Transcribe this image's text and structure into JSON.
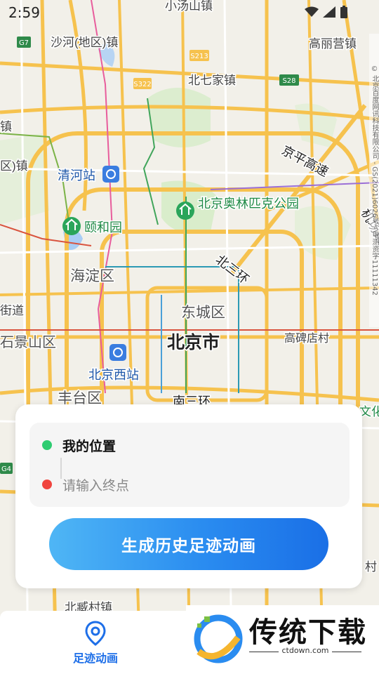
{
  "status_bar": {
    "time": "2:59"
  },
  "map": {
    "copyright": "© 北京百度网讯科技有限公司 - GS(2021)6026号 - 甲测资字11111342",
    "labels": {
      "xiaotangshan": "小汤山镇",
      "shahe": "沙河(地区)镇",
      "gaoliying": "高丽营镇",
      "beiqijia": "北七家镇",
      "s28": "S28",
      "g7": "G7",
      "s213": "S213",
      "s322": "S322",
      "g4": "G4",
      "zhen_left1": "镇",
      "zhen_left2": "区)镇",
      "jingping": "京平高速",
      "jichang": "机场第二高速",
      "qinghe_station": "清河站",
      "olympic": "北京奥林匹克公园",
      "yiheyuan": "颐和园",
      "beisanhuan": "北三环",
      "haidian": "海淀区",
      "dongcheng": "东城区",
      "beijing": "北京市",
      "gaobeidian": "高碑店村",
      "shijingshan": "石景山区",
      "jiedao": "街道",
      "beijingxi": "北京西站",
      "fengtai": "丰台区",
      "nansanhuan": "南三环",
      "beizangcun": "北臧村镇",
      "right_wen": "文化",
      "right_cun": "村"
    }
  },
  "route_card": {
    "from_label": "我的位置",
    "to_placeholder": "请输入终点",
    "generate_button": "生成历史足迹动画",
    "colors": {
      "from_dot": "#2ecc71",
      "to_dot": "#f0443e"
    }
  },
  "bottom_nav": {
    "tabs": [
      {
        "label": "足迹动画",
        "icon": "location-pin-icon",
        "active": true
      }
    ]
  },
  "watermark": {
    "name": "传统下载",
    "url": "ctdown.com"
  }
}
